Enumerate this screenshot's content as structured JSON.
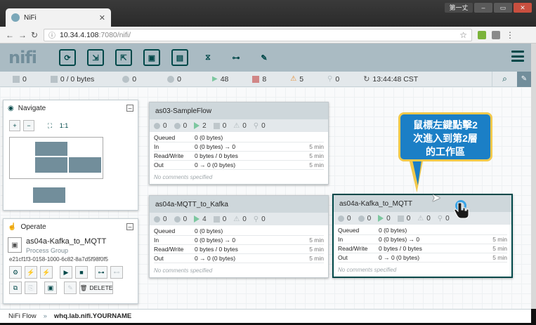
{
  "browser": {
    "tab_title": "NiFi",
    "url_host": "10.34.4.108",
    "url_path": ":7080/nifi/",
    "window_user": "第一丈"
  },
  "app": {
    "logo": "nifi"
  },
  "status": {
    "active_threads": "0",
    "queued": "0 / 0 bytes",
    "transmitting": "0",
    "not_transmitting": "0",
    "running": "48",
    "stopped": "8",
    "invalid": "5",
    "disabled": "0",
    "refresh_time": "13:44:48 CST"
  },
  "navigate": {
    "title": "Navigate"
  },
  "operate": {
    "title": "Operate",
    "component_name": "as04a-Kafka_to_MQTT",
    "component_type": "Process Group",
    "component_id": "e21cf1f3-0158-1000-6c82-8a7d5f98f0f5",
    "delete_label": "DELETE"
  },
  "process_groups": [
    {
      "name": "as03-SampleFlow",
      "stats": [
        "0",
        "0",
        "2",
        "0",
        "0",
        "0"
      ],
      "rows": [
        {
          "label": "Queued",
          "value": "0 (0 bytes)",
          "window": ""
        },
        {
          "label": "In",
          "value": "0 (0 bytes) → 0",
          "window": "5 min"
        },
        {
          "label": "Read/Write",
          "value": "0 bytes / 0 bytes",
          "window": "5 min"
        },
        {
          "label": "Out",
          "value": "0 → 0 (0 bytes)",
          "window": "5 min"
        }
      ],
      "comments": "No comments specified"
    },
    {
      "name": "as04a-MQTT_to_Kafka",
      "stats": [
        "0",
        "0",
        "4",
        "0",
        "0",
        "0"
      ],
      "rows": [
        {
          "label": "Queued",
          "value": "0 (0 bytes)",
          "window": ""
        },
        {
          "label": "In",
          "value": "0 (0 bytes) → 0",
          "window": "5 min"
        },
        {
          "label": "Read/Write",
          "value": "0 bytes / 0 bytes",
          "window": "5 min"
        },
        {
          "label": "Out",
          "value": "0 → 0 (0 bytes)",
          "window": "5 min"
        }
      ],
      "comments": "No comments specified"
    },
    {
      "name": "as04a-Kafka_to_MQTT",
      "stats": [
        "0",
        "0",
        "0",
        "0",
        "0",
        "0"
      ],
      "rows": [
        {
          "label": "Queued",
          "value": "0 (0 bytes)",
          "window": ""
        },
        {
          "label": "In",
          "value": "0 (0 bytes) → 0",
          "window": "5 min"
        },
        {
          "label": "Read/Write",
          "value": "0 bytes / 0 bytes",
          "window": "5 min"
        },
        {
          "label": "Out",
          "value": "0 → 0 (0 bytes)",
          "window": "5 min"
        }
      ],
      "comments": "No comments specified"
    }
  ],
  "callout": {
    "line1": "鼠標左鍵點擊2",
    "line2": "次進入到第2層",
    "line3": "的工作區"
  },
  "breadcrumb": {
    "root": "NiFi Flow",
    "separator": "»",
    "current": "whq.lab.nifi.YOURNAME"
  }
}
